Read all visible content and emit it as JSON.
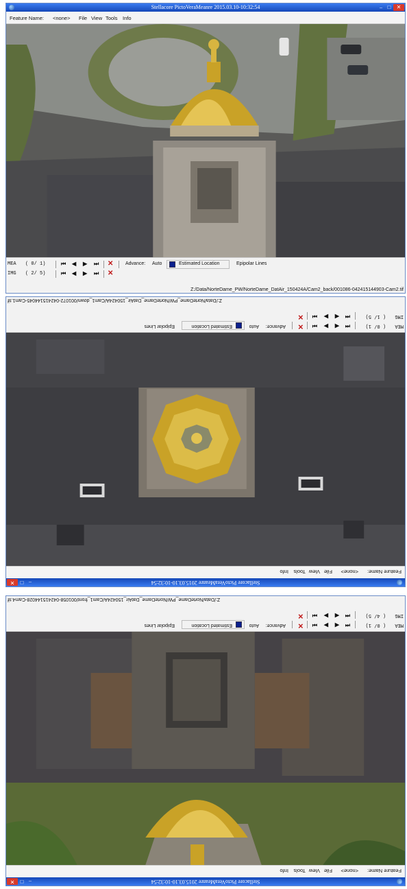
{
  "windows": [
    {
      "title": "Stellacore PictoVeraMeanre 2015.03.10-10:32:54",
      "menu": {
        "feature_name_label": "Feature Name:",
        "feature_name_value": "<none>",
        "file": "File",
        "view": "View",
        "tools": "Tools",
        "info": "Info"
      },
      "controls": {
        "mea_label": "MEA",
        "mea_frame": "( 0/ 1)",
        "img_label": "IMG",
        "img_frame": "( 2/ 5)",
        "advance_label": "Advance:",
        "advance_value": "Auto",
        "estimated_location": "Estimated Location",
        "epipolar_lines": "Epipolar Lines"
      },
      "path": "Z:/Data/NorteDame_PW/NorteDame_DatAir_150424A/Cam2_back/001086-042415144903-Cam2.tif"
    },
    {
      "title": "Stellacore PictoVeraMeanre 2015.03.10-10:32:54",
      "menu": {
        "feature_name_label": "Feature Name:",
        "feature_name_value": "<none>",
        "file": "File",
        "view": "View",
        "tools": "Tools",
        "info": "Info"
      },
      "controls": {
        "mea_label": "MEA",
        "mea_frame": "( 0/ 1)",
        "img_label": "IMG",
        "img_frame": "( 1/ 5)",
        "advance_label": "Advance:",
        "advance_value": "Auto",
        "estimated_location": "Estimated Location",
        "epipolar_lines": "Epipolar Lines"
      },
      "path": "Z:/Data/NorteDame_PW/NorteDame_DatAir_150424A/Cam1_down/001072-042415144045-Cam1.tif"
    },
    {
      "title": "Stellacore PictoVeraMeanre 2015.03.10-10:32:54",
      "menu": {
        "feature_name_label": "Feature Name:",
        "feature_name_value": "<none>",
        "file": "File",
        "view": "View",
        "tools": "Tools",
        "info": "Info"
      },
      "controls": {
        "mea_label": "MEA",
        "mea_frame": "( 0/ 1)",
        "img_label": "IMG",
        "img_frame": "( 4/ 5)",
        "advance_label": "Advance:",
        "advance_value": "Auto",
        "estimated_location": "Estimated Location",
        "epipolar_lines": "Epipolar Lines"
      },
      "path": "Z:/Data/NorteDame_PW/NorteDame_DatAir_150424A/Cam1_front/001058-042415144028-Cam4.tif"
    }
  ],
  "nav_icons": [
    "first-icon",
    "prev-icon",
    "next-icon",
    "last-icon",
    "clear-icon"
  ],
  "colors": {
    "title_bar": "#1c5bd1",
    "close_button": "#d93a2a",
    "clear_x": "#c01818",
    "estimated_box": "#0a1f8c",
    "dome_gold": "#c9a227"
  }
}
